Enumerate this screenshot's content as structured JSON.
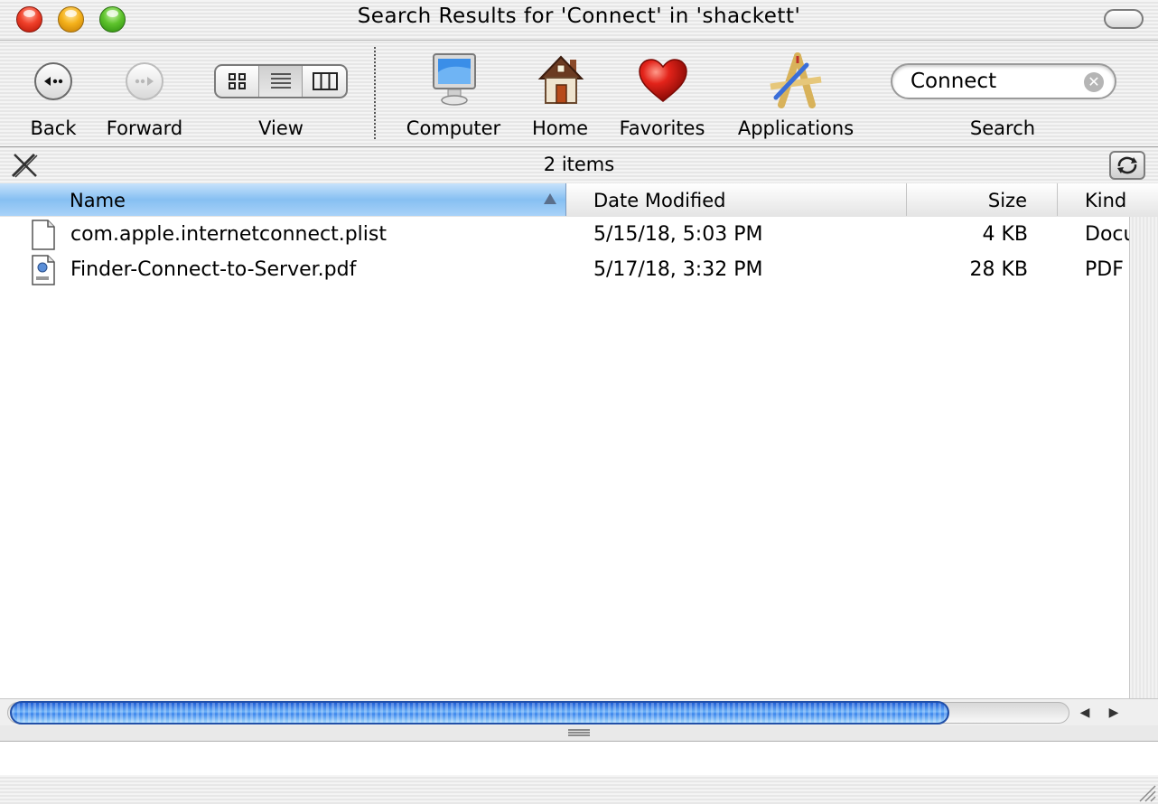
{
  "window": {
    "title": "Search Results for 'Connect' in 'shackett'"
  },
  "toolbar": {
    "back_label": "Back",
    "forward_label": "Forward",
    "view_label": "View",
    "computer_label": "Computer",
    "home_label": "Home",
    "favorites_label": "Favorites",
    "applications_label": "Applications",
    "search_label": "Search",
    "search_value": "Connect"
  },
  "status": {
    "item_count": "2 items"
  },
  "columns": {
    "name": "Name",
    "date_modified": "Date Modified",
    "size": "Size",
    "kind": "Kind"
  },
  "files": [
    {
      "name": "com.apple.internetconnect.plist",
      "date_modified": "5/15/18, 5:03 PM",
      "size": "4 KB",
      "kind": "Document",
      "icon": "document-icon"
    },
    {
      "name": "Finder-Connect-to-Server.pdf",
      "date_modified": "5/17/18, 3:32 PM",
      "size": "28 KB",
      "kind": "PDF",
      "icon": "pdf-icon"
    }
  ],
  "colors": {
    "selected_column": "#86bff2",
    "scroll_thumb": "#3b85ec",
    "close": "#f0402a",
    "minimize": "#f5b21b",
    "zoom": "#5ec32c"
  }
}
